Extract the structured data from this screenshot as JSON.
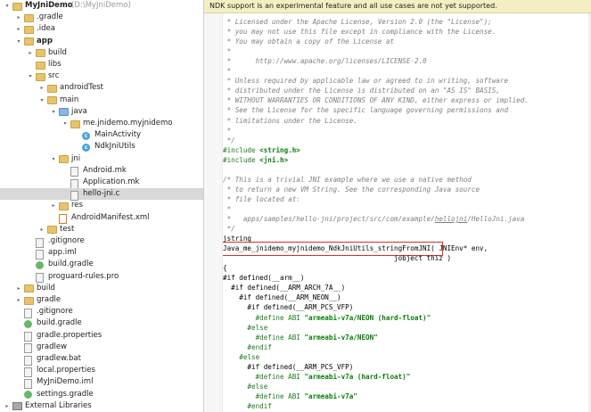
{
  "project": {
    "rows": [
      {
        "label": "MyJniDemo",
        "suffix": "(D:\\MyJniDemo)",
        "icon": "folder-icon",
        "type": "folder",
        "arrow": "▾",
        "indent": 0,
        "bold": true
      },
      {
        "label": ".gradle",
        "icon": "folder-icon",
        "type": "folder",
        "arrow": "▸",
        "indent": 1,
        "selected": true
      },
      {
        "label": ".idea",
        "icon": "folder-icon",
        "type": "folder",
        "arrow": "▸",
        "indent": 1
      },
      {
        "label": "app",
        "icon": "folder-icon",
        "type": "folder",
        "arrow": "▾",
        "indent": 1,
        "bold": true
      },
      {
        "label": "build",
        "icon": "folder-icon",
        "type": "folder",
        "arrow": "▸",
        "indent": 2
      },
      {
        "label": "libs",
        "icon": "folder-icon",
        "type": "folder",
        "arrow": "",
        "indent": 2
      },
      {
        "label": "src",
        "icon": "folder-icon",
        "type": "folder",
        "arrow": "▾",
        "indent": 2
      },
      {
        "label": "androidTest",
        "icon": "folder-icon",
        "type": "folder",
        "arrow": "▸",
        "indent": 3
      },
      {
        "label": "main",
        "icon": "folder-icon",
        "type": "folder",
        "arrow": "▾",
        "indent": 3
      },
      {
        "label": "java",
        "icon": "folder-icon",
        "type": "folder-blue",
        "arrow": "▾",
        "indent": 4
      },
      {
        "label": "me.jnidemo.myjnidemo",
        "icon": "package-icon",
        "type": "folder",
        "arrow": "▾",
        "indent": 5
      },
      {
        "label": "MainActivity",
        "icon": "class-icon",
        "type": "cls",
        "arrow": "",
        "indent": 6
      },
      {
        "label": "NdkJniUtils",
        "icon": "class-icon",
        "type": "cls",
        "arrow": "",
        "indent": 6
      },
      {
        "label": "jni",
        "icon": "folder-icon",
        "type": "folder",
        "arrow": "▾",
        "indent": 4
      },
      {
        "label": "Android.mk",
        "icon": "file-icon",
        "type": "file",
        "arrow": "",
        "indent": 5
      },
      {
        "label": "Application.mk",
        "icon": "file-icon",
        "type": "file",
        "arrow": "",
        "indent": 5
      },
      {
        "label": "hello-jni.c",
        "icon": "file-icon",
        "type": "file",
        "arrow": "",
        "indent": 5,
        "highlighted": true
      },
      {
        "label": "res",
        "icon": "folder-icon",
        "type": "folder",
        "arrow": "▸",
        "indent": 4
      },
      {
        "label": "AndroidManifest.xml",
        "icon": "xml-file-icon",
        "type": "xml",
        "arrow": "",
        "indent": 4
      },
      {
        "label": "test",
        "icon": "folder-icon",
        "type": "folder",
        "arrow": "▸",
        "indent": 3
      },
      {
        "label": ".gitignore",
        "icon": "file-icon",
        "type": "file",
        "arrow": "",
        "indent": 2
      },
      {
        "label": "app.iml",
        "icon": "file-icon",
        "type": "file",
        "arrow": "",
        "indent": 2
      },
      {
        "label": "build.gradle",
        "icon": "gradle-icon",
        "type": "gradle",
        "arrow": "",
        "indent": 2
      },
      {
        "label": "proguard-rules.pro",
        "icon": "file-icon",
        "type": "file",
        "arrow": "",
        "indent": 2
      },
      {
        "label": "build",
        "icon": "folder-icon",
        "type": "folder",
        "arrow": "▸",
        "indent": 1
      },
      {
        "label": "gradle",
        "icon": "folder-icon",
        "type": "folder",
        "arrow": "▸",
        "indent": 1
      },
      {
        "label": ".gitignore",
        "icon": "file-icon",
        "type": "file",
        "arrow": "",
        "indent": 1
      },
      {
        "label": "build.gradle",
        "icon": "gradle-icon",
        "type": "gradle",
        "arrow": "",
        "indent": 1
      },
      {
        "label": "gradle.properties",
        "icon": "file-icon",
        "type": "file",
        "arrow": "",
        "indent": 1
      },
      {
        "label": "gradlew",
        "icon": "file-icon",
        "type": "file",
        "arrow": "",
        "indent": 1
      },
      {
        "label": "gradlew.bat",
        "icon": "file-icon",
        "type": "file",
        "arrow": "",
        "indent": 1
      },
      {
        "label": "local.properties",
        "icon": "file-icon",
        "type": "file",
        "arrow": "",
        "indent": 1
      },
      {
        "label": "MyJniDemo.iml",
        "icon": "file-icon",
        "type": "file",
        "arrow": "",
        "indent": 1
      },
      {
        "label": "settings.gradle",
        "icon": "gradle-icon",
        "type": "gradle",
        "arrow": "",
        "indent": 1
      },
      {
        "label": "External Libraries",
        "icon": "library-icon",
        "type": "lib",
        "arrow": "▸",
        "indent": 0
      }
    ]
  },
  "banner": {
    "text": "NDK support is an experimental feature and all use cases are not yet supported."
  },
  "editor": {
    "lines": [
      {
        "kind": "cm",
        "text": " * Licensed under the Apache License, Version 2.0 (the \"License\");"
      },
      {
        "kind": "cm",
        "text": " * you may not use this file except in compliance with the License."
      },
      {
        "kind": "cm",
        "text": " * You may obtain a copy of the License at"
      },
      {
        "kind": "cm",
        "text": " *"
      },
      {
        "kind": "cm",
        "text": " *      http://www.apache.org/licenses/LICENSE-2.0"
      },
      {
        "kind": "cm",
        "text": " *"
      },
      {
        "kind": "cm",
        "text": " * Unless required by applicable law or agreed to in writing, software"
      },
      {
        "kind": "cm",
        "text": " * distributed under the License is distributed on an \"AS IS\" BASIS,"
      },
      {
        "kind": "cm",
        "text": " * WITHOUT WARRANTIES OR CONDITIONS OF ANY KIND, either express or implied."
      },
      {
        "kind": "cm",
        "text": " * See the License for the specific language governing permissions and"
      },
      {
        "kind": "cm",
        "text": " * limitations under the License."
      },
      {
        "kind": "cm",
        "text": " *"
      },
      {
        "kind": "cm",
        "text": " */"
      },
      {
        "kind": "include",
        "directive": "#include ",
        "arg": "<string.h>"
      },
      {
        "kind": "include",
        "directive": "#include ",
        "arg": "<jni.h>"
      },
      {
        "kind": "blank",
        "text": ""
      },
      {
        "kind": "cm",
        "text": "/* This is a trivial JNI example where we use a native method"
      },
      {
        "kind": "cm",
        "text": " * to return a new VM String. See the corresponding Java source"
      },
      {
        "kind": "cm",
        "text": " * file located at:"
      },
      {
        "kind": "cm",
        "text": " *"
      },
      {
        "kind": "cm",
        "text": " *   apps/samples/hello-jni/project/src/com/example/hellojni/HelloJni.java"
      },
      {
        "kind": "cm",
        "text": " */"
      },
      {
        "kind": "code",
        "text": "jstring"
      },
      {
        "kind": "fn",
        "name": "Java_me_jnidemo_myjnidemo_NdkJniUtils_stringFromJNI",
        "rest": "( JNIEnv* env,"
      },
      {
        "kind": "code",
        "text": "                                          jobject thiz )"
      },
      {
        "kind": "code",
        "text": "{"
      },
      {
        "kind": "code",
        "text": "#if defined(__arm__)"
      },
      {
        "kind": "code",
        "text": "  #if defined(__ARM_ARCH_7A__)"
      },
      {
        "kind": "code",
        "text": "    #if defined(__ARM_NEON__)"
      },
      {
        "kind": "code",
        "text": "      #if defined(__ARM_PCS_VFP)"
      },
      {
        "kind": "define",
        "prefix": "        #define ABI ",
        "value": "\"armeabi-v7a/NEON (hard-float)\""
      },
      {
        "kind": "pp",
        "text": "      #else"
      },
      {
        "kind": "define",
        "prefix": "        #define ABI ",
        "value": "\"armeabi-v7a/NEON\""
      },
      {
        "kind": "pp",
        "text": "      #endif"
      },
      {
        "kind": "pp",
        "text": "    #else"
      },
      {
        "kind": "code",
        "text": "      #if defined(__ARM_PCS_VFP)"
      },
      {
        "kind": "define",
        "prefix": "        #define ABI ",
        "value": "\"armeabi-v7a (hard-float)\""
      },
      {
        "kind": "pp",
        "text": "      #else"
      },
      {
        "kind": "define",
        "prefix": "        #define ABI ",
        "value": "\"armeabi-v7a\""
      },
      {
        "kind": "pp",
        "text": "      #endif"
      }
    ]
  }
}
